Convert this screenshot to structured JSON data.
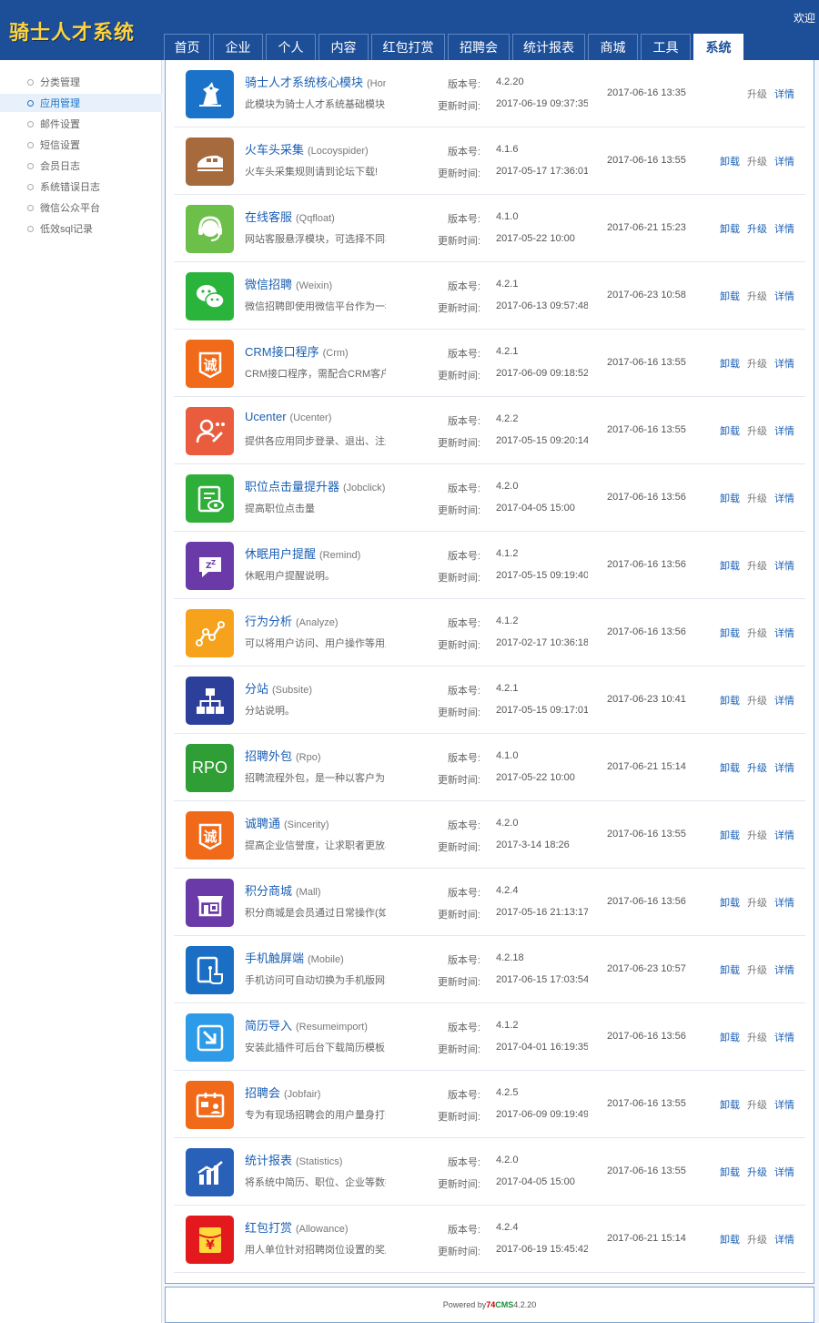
{
  "header": {
    "logo": "骑士人才系统",
    "welcome": "欢迎"
  },
  "nav": [
    {
      "label": "首页",
      "w": 51
    },
    {
      "label": "企业",
      "w": 55
    },
    {
      "label": "个人",
      "w": 55
    },
    {
      "label": "内容",
      "w": 55
    },
    {
      "label": "红包打赏",
      "w": 81
    },
    {
      "label": "招聘会",
      "w": 68
    },
    {
      "label": "统计报表",
      "w": 80
    },
    {
      "label": "商城",
      "w": 55
    },
    {
      "label": "工具",
      "w": 55
    },
    {
      "label": "系统",
      "w": 55,
      "active": true
    }
  ],
  "sidebar": [
    {
      "label": "分类管理"
    },
    {
      "label": "应用管理",
      "active": true
    },
    {
      "label": "邮件设置"
    },
    {
      "label": "短信设置"
    },
    {
      "label": "会员日志"
    },
    {
      "label": "系统错误日志"
    },
    {
      "label": "微信公众平台"
    },
    {
      "label": "低效sql记录"
    }
  ],
  "labels": {
    "version": "版本号:",
    "updated": "更新时间:",
    "uninstall": "卸载",
    "upgrade": "升级",
    "details": "详情"
  },
  "apps": [
    {
      "name": "骑士人才系统核心模块",
      "code": "(Home)",
      "desc": "此模块为骑士人才系统基础模块",
      "version": "4.2.20",
      "updated": "2017-06-19 09:37:35",
      "installed": "2017-06-16 13:35",
      "icon": "knight-icon",
      "color": "#1a72c9",
      "uninstall": false,
      "upgrade_active": false
    },
    {
      "name": "火车头采集",
      "code": "(Locoyspider)",
      "desc": "火车头采集规则请到论坛下载!",
      "version": "4.1.6",
      "updated": "2017-05-17 17:36:01",
      "installed": "2017-06-16 13:55",
      "icon": "train-icon",
      "color": "#a66a3d",
      "uninstall": true,
      "upgrade_active": false
    },
    {
      "name": "在线客服",
      "code": "(Qqfloat)",
      "desc": "网站客服悬浮模块，可选择不同样式",
      "version": "4.1.0",
      "updated": "2017-05-22 10:00",
      "installed": "2017-06-21 15:23",
      "icon": "headset-icon",
      "color": "#6cc04a",
      "uninstall": true,
      "upgrade_active": true
    },
    {
      "name": "微信招聘",
      "code": "(Weixin)",
      "desc": "微信招聘即使用微信平台作为一种招聘渠道",
      "version": "4.2.1",
      "updated": "2017-06-13 09:57:48",
      "installed": "2017-06-23 10:58",
      "icon": "wechat-icon",
      "color": "#2bb43b",
      "uninstall": true,
      "upgrade_active": false
    },
    {
      "name": "CRM接口程序",
      "code": "(Crm)",
      "desc": "CRM接口程序，需配合CRM客户端使用",
      "version": "4.2.1",
      "updated": "2017-06-09 09:18:52",
      "installed": "2017-06-16 13:55",
      "icon": "cheng-badge-icon",
      "color": "#f06a1a",
      "uninstall": true,
      "upgrade_active": false
    },
    {
      "name": "Ucenter",
      "code": "(Ucenter)",
      "desc": "提供各应用同步登录、退出、注册等",
      "version": "4.2.2",
      "updated": "2017-05-15 09:20:14",
      "installed": "2017-06-16 13:55",
      "icon": "user-link-icon",
      "color": "#e95c3d",
      "uninstall": true,
      "upgrade_active": false
    },
    {
      "name": "职位点击量提升器",
      "code": "(Jobclick)",
      "desc": "提高职位点击量",
      "version": "4.2.0",
      "updated": "2017-04-05 15:00",
      "installed": "2017-06-16 13:56",
      "icon": "view-doc-icon",
      "color": "#2fae3a",
      "uninstall": true,
      "upgrade_active": false
    },
    {
      "name": "休眠用户提醒",
      "code": "(Remind)",
      "desc": "休眠用户提醒说明。",
      "version": "4.1.2",
      "updated": "2017-05-15 09:19:40",
      "installed": "2017-06-16 13:56",
      "icon": "sleep-bubble-icon",
      "color": "#6a3aa8",
      "uninstall": true,
      "upgrade_active": false
    },
    {
      "name": "行为分析",
      "code": "(Analyze)",
      "desc": "可以将用户访问、用户操作等用户行为",
      "version": "4.1.2",
      "updated": "2017-02-17 10:36:18",
      "installed": "2017-06-16 13:56",
      "icon": "trend-line-icon",
      "color": "#f7a21c",
      "uninstall": true,
      "upgrade_active": false
    },
    {
      "name": "分站",
      "code": "(Subsite)",
      "desc": "分站说明。",
      "version": "4.2.1",
      "updated": "2017-05-15 09:17:01",
      "installed": "2017-06-23 10:41",
      "icon": "sitemap-icon",
      "color": "#2c3f9a",
      "uninstall": true,
      "upgrade_active": false
    },
    {
      "name": "招聘外包",
      "code": "(Rpo)",
      "desc": "招聘流程外包，是一种以客户为中心",
      "version": "4.1.0",
      "updated": "2017-05-22 10:00",
      "installed": "2017-06-21 15:14",
      "icon": "rpo-text-icon",
      "icon_text": "RPO",
      "color": "#2f9e35",
      "uninstall": true,
      "upgrade_active": true
    },
    {
      "name": "诚聘通",
      "code": "(Sincerity)",
      "desc": "提高企业信誉度，让求职者更放心",
      "version": "4.2.0",
      "updated": "2017-3-14 18:26",
      "installed": "2017-06-16 13:55",
      "icon": "cheng-badge-icon",
      "color": "#f06a1a",
      "uninstall": true,
      "upgrade_active": false
    },
    {
      "name": "积分商城",
      "code": "(Mall)",
      "desc": "积分商城是会员通过日常操作(如登录)",
      "version": "4.2.4",
      "updated": "2017-05-16 21:13:17",
      "installed": "2017-06-16 13:56",
      "icon": "store-icon",
      "color": "#6a3aa8",
      "uninstall": true,
      "upgrade_active": false
    },
    {
      "name": "手机触屏端",
      "code": "(Mobile)",
      "desc": "手机访问可自动切换为手机版网站",
      "version": "4.2.18",
      "updated": "2017-06-15 17:03:54",
      "installed": "2017-06-23 10:57",
      "icon": "touch-screen-icon",
      "color": "#1a6fc4",
      "uninstall": true,
      "upgrade_active": false
    },
    {
      "name": "简历导入",
      "code": "(Resumeimport)",
      "desc": "安装此插件可后台下载简历模板",
      "version": "4.1.2",
      "updated": "2017-04-01 16:19:35",
      "installed": "2017-06-16 13:56",
      "icon": "import-arrow-icon",
      "color": "#2e9be8",
      "uninstall": true,
      "upgrade_active": false
    },
    {
      "name": "招聘会",
      "code": "(Jobfair)",
      "desc": "专为有现场招聘会的用户量身打造",
      "version": "4.2.5",
      "updated": "2017-06-09 09:19:49",
      "installed": "2017-06-16 13:55",
      "icon": "id-card-icon",
      "color": "#f06a1a",
      "uninstall": true,
      "upgrade_active": false
    },
    {
      "name": "统计报表",
      "code": "(Statistics)",
      "desc": "将系统中简历、职位、企业等数据统计",
      "version": "4.2.0",
      "updated": "2017-04-05 15:00",
      "installed": "2017-06-16 13:55",
      "icon": "bar-chart-icon",
      "color": "#2a61b8",
      "uninstall": true,
      "upgrade_active": true
    },
    {
      "name": "红包打赏",
      "code": "(Allowance)",
      "desc": "用人单位针对招聘岗位设置的奖励",
      "version": "4.2.4",
      "updated": "2017-06-19 15:45:42",
      "installed": "2017-06-21 15:14",
      "icon": "red-envelope-icon",
      "color": "#e3191e",
      "uninstall": true,
      "upgrade_active": false
    }
  ],
  "footer": {
    "prefix": "Powered by ",
    "brand_a": "74",
    "brand_b": "CMS",
    "version": " 4.2.20"
  }
}
